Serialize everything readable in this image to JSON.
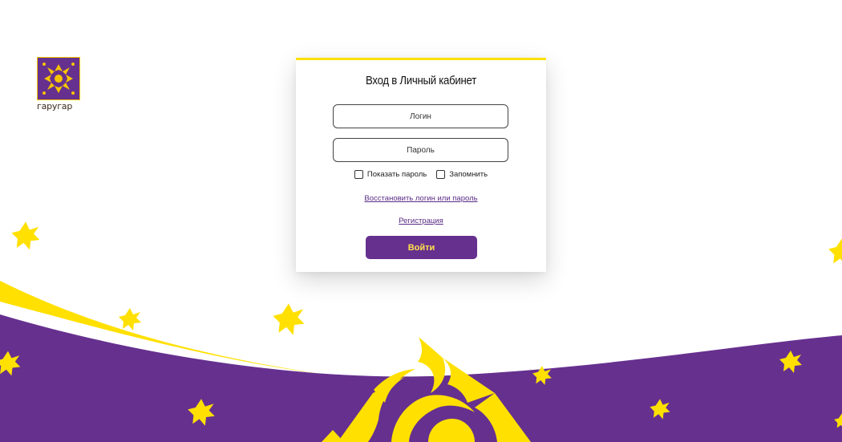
{
  "brand": {
    "logo_text": "гаругар",
    "logo_icon": "sun-ornament-icon",
    "colors": {
      "purple": "#66308f",
      "yellow": "#ffe000",
      "white": "#ffffff"
    }
  },
  "login_form": {
    "title": "Вход в Личный кабинет",
    "login_placeholder": "Логин",
    "password_placeholder": "Пароль",
    "show_password_label": "Показать пароль",
    "remember_label": "Запомнить",
    "restore_link": "Восстановить логин или пароль",
    "register_link": "Регистрация",
    "submit_label": "Войти"
  }
}
